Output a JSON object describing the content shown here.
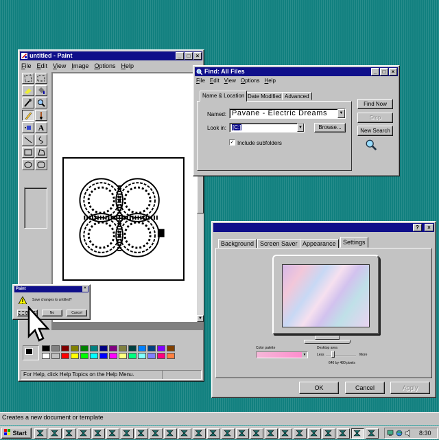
{
  "paint": {
    "title": "untitled - Paint",
    "menus": [
      "File",
      "Edit",
      "View",
      "Image",
      "Options",
      "Help"
    ],
    "status": "For Help, click Help Topics on the Help Menu.",
    "title_buttons": [
      "_",
      "□",
      "×"
    ]
  },
  "find": {
    "title": "Find: All Files",
    "menus": [
      "File",
      "Edit",
      "View",
      "Options",
      "Help"
    ],
    "tabs": [
      "Name & Location",
      "Date Modified",
      "Advanced"
    ],
    "named_label": "Named:",
    "named_value": "Pavane - Electric Dreams",
    "look_in_label": "Look in:",
    "look_in_value": "[C:]",
    "browse_label": "Browse...",
    "subfolders_label": "Include subfolders",
    "find_now_label": "Find Now",
    "stop_label": "Stop",
    "new_search_label": "New Search"
  },
  "display": {
    "title_buttons": [
      "?",
      "×"
    ],
    "tabs": [
      "Background",
      "Screen Saver",
      "Appearance",
      "Settings"
    ],
    "color_palette_label": "Color palette",
    "desktop_area_label": "Desktop area",
    "less_label": "Less",
    "more_label": "More",
    "resolution_label": "640 by 480 pixels",
    "ok_label": "OK",
    "cancel_label": "Cancel",
    "apply_label": "Apply"
  },
  "dialog": {
    "title": "Paint",
    "message": "Save changes to untitled?",
    "yes_label": "Yes",
    "no_label": "No",
    "cancel_label": "Cancel"
  },
  "desktop": {
    "status_line": "Creates a new document or template"
  },
  "taskbar": {
    "start_label": "Start",
    "clock": "8:30"
  },
  "palette_colors": [
    "#000000",
    "#808080",
    "#800000",
    "#808000",
    "#008000",
    "#008080",
    "#000080",
    "#800080",
    "#808040",
    "#004040",
    "#0080ff",
    "#004080",
    "#8000ff",
    "#804000",
    "#ffffff",
    "#c0c0c0",
    "#ff0000",
    "#ffff00",
    "#00ff00",
    "#00ffff",
    "#0000ff",
    "#ff00ff",
    "#ffff80",
    "#00ff80",
    "#80ffff",
    "#8080ff",
    "#ff0080",
    "#ff8040"
  ]
}
